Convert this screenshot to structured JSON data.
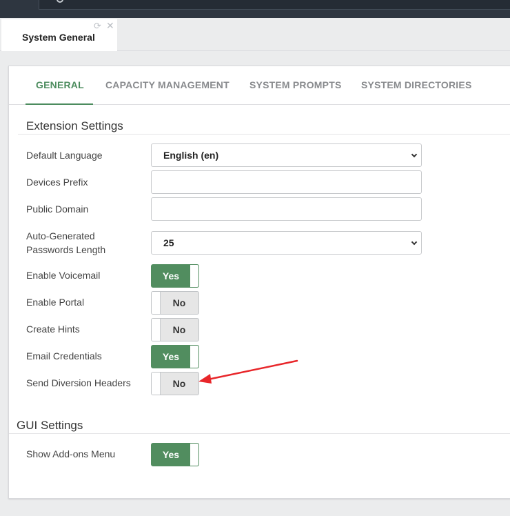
{
  "tab": {
    "title": "System General"
  },
  "settings_tabs": [
    "GENERAL",
    "CAPACITY MANAGEMENT",
    "SYSTEM PROMPTS",
    "SYSTEM DIRECTORIES"
  ],
  "extension": {
    "title": "Extension Settings",
    "default_language": {
      "label": "Default Language",
      "value": "English (en)"
    },
    "devices_prefix": {
      "label": "Devices Prefix",
      "value": ""
    },
    "public_domain": {
      "label": "Public Domain",
      "value": ""
    },
    "password_length": {
      "label_line1": "Auto-Generated",
      "label_line2": "Passwords Length",
      "value": "25"
    },
    "enable_voicemail": {
      "label": "Enable Voicemail",
      "state": "Yes"
    },
    "enable_portal": {
      "label": "Enable Portal",
      "state": "No"
    },
    "create_hints": {
      "label": "Create Hints",
      "state": "No"
    },
    "email_credentials": {
      "label": "Email Credentials",
      "state": "Yes"
    },
    "send_diversion_headers": {
      "label": "Send Diversion Headers",
      "state": "No"
    }
  },
  "gui": {
    "title": "GUI Settings",
    "show_addons_menu": {
      "label": "Show Add-ons Menu",
      "state": "Yes"
    }
  },
  "colors": {
    "accent": "#4c8c5e",
    "toggle_on": "#518d5f",
    "annotation_arrow": "#e8262a"
  }
}
